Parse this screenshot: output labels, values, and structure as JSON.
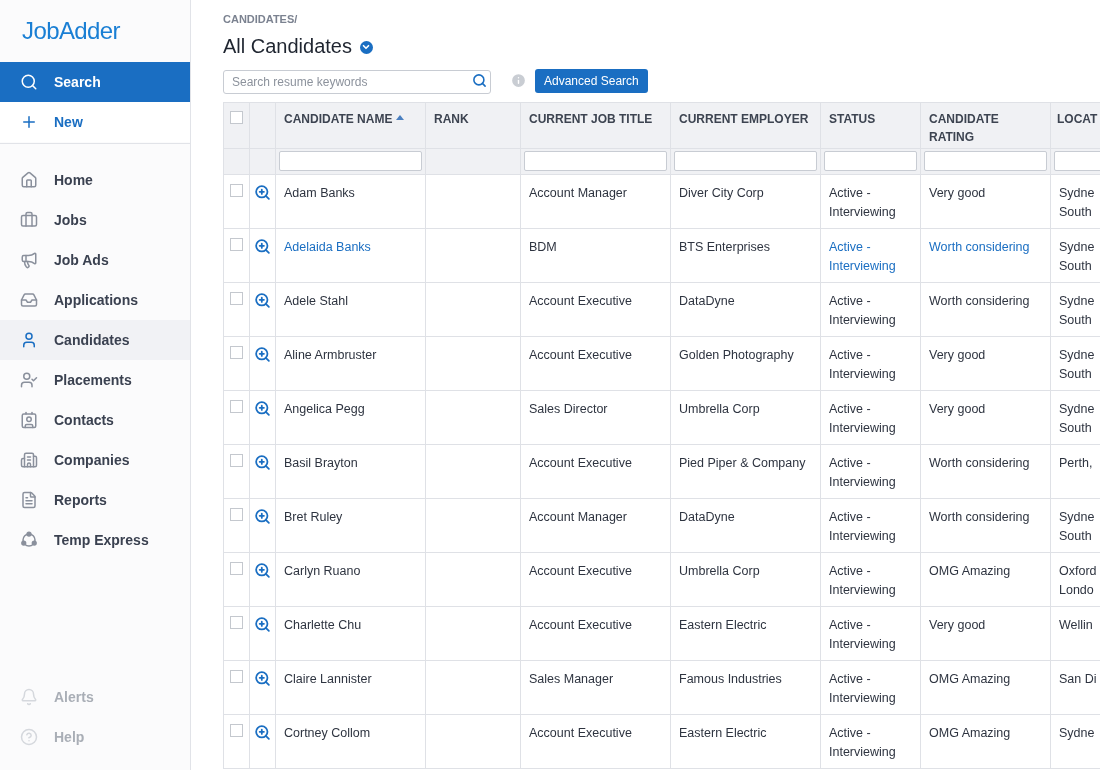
{
  "sidebar": {
    "logo": "JobAdder",
    "actions": [
      {
        "label": "Search",
        "selected": true
      },
      {
        "label": "New",
        "selected": false
      }
    ],
    "items": [
      {
        "label": "Home",
        "selected": false,
        "disabled": false
      },
      {
        "label": "Jobs",
        "selected": false,
        "disabled": false
      },
      {
        "label": "Job Ads",
        "selected": false,
        "disabled": false
      },
      {
        "label": "Applications",
        "selected": false,
        "disabled": false
      },
      {
        "label": "Candidates",
        "selected": true,
        "disabled": false
      },
      {
        "label": "Placements",
        "selected": false,
        "disabled": false
      },
      {
        "label": "Contacts",
        "selected": false,
        "disabled": false
      },
      {
        "label": "Companies",
        "selected": false,
        "disabled": false
      },
      {
        "label": "Reports",
        "selected": false,
        "disabled": false
      },
      {
        "label": "Temp Express",
        "selected": false,
        "disabled": false
      }
    ],
    "footer": [
      {
        "label": "Alerts",
        "disabled": true
      },
      {
        "label": "Help",
        "disabled": true
      }
    ]
  },
  "breadcrumb": "CANDIDATES/",
  "title": "All Candidates",
  "search": {
    "placeholder": "Search resume keywords"
  },
  "advanced_search": "Advanced Search",
  "table": {
    "select_all": {
      "checked": false
    },
    "columns": [
      {
        "label": "CANDIDATE NAME",
        "sorted": true
      },
      {
        "label": "RANK",
        "sorted": false
      },
      {
        "label": "CURRENT JOB TITLE",
        "sorted": false
      },
      {
        "label": "CURRENT EMPLOYER",
        "sorted": false
      },
      {
        "label": "STATUS",
        "sorted": false
      },
      {
        "label": "CANDIDATE RATING",
        "sorted": false
      },
      {
        "label": "LOCAT",
        "sorted": false
      }
    ],
    "rows": [
      {
        "checked": false,
        "highlighted": false,
        "name": "Adam Banks",
        "job_title": "Account Manager",
        "employer": "Diver City Corp",
        "status": "Active - Interviewing",
        "rating": "Very good",
        "location": [
          "Sydne",
          "South"
        ]
      },
      {
        "checked": false,
        "highlighted": true,
        "name": "Adelaida Banks",
        "job_title": "BDM",
        "employer": "BTS Enterprises",
        "status": "Active - Interviewing",
        "rating": "Worth considering",
        "location": [
          "Sydne",
          "South"
        ]
      },
      {
        "checked": false,
        "highlighted": false,
        "name": "Adele Stahl",
        "job_title": "Account Executive",
        "employer": "DataDyne",
        "status": "Active - Interviewing",
        "rating": "Worth considering",
        "location": [
          "Sydne",
          "South"
        ]
      },
      {
        "checked": false,
        "highlighted": false,
        "name": "Aline Armbruster",
        "job_title": "Account Executive",
        "employer": "Golden Photography",
        "status": "Active - Interviewing",
        "rating": "Very good",
        "location": [
          "Sydne",
          "South"
        ]
      },
      {
        "checked": false,
        "highlighted": false,
        "name": "Angelica Pegg",
        "job_title": "Sales Director",
        "employer": "Umbrella Corp",
        "status": "Active - Interviewing",
        "rating": "Very good",
        "location": [
          "Sydne",
          "South"
        ]
      },
      {
        "checked": false,
        "highlighted": false,
        "name": "Basil Brayton",
        "job_title": "Account Executive",
        "employer": "Pied Piper & Company",
        "status": "Active - Interviewing",
        "rating": "Worth considering",
        "location": [
          "Perth,"
        ]
      },
      {
        "checked": false,
        "highlighted": false,
        "name": "Bret Ruley",
        "job_title": "Account Manager",
        "employer": "DataDyne",
        "status": "Active - Interviewing",
        "rating": "Worth considering",
        "location": [
          "Sydne",
          "South"
        ]
      },
      {
        "checked": false,
        "highlighted": false,
        "name": "Carlyn Ruano",
        "job_title": "Account Executive",
        "employer": "Umbrella Corp",
        "status": "Active - Interviewing",
        "rating": "OMG Amazing",
        "location": [
          "Oxford",
          "Londo"
        ]
      },
      {
        "checked": false,
        "highlighted": false,
        "name": "Charlette Chu",
        "job_title": "Account Executive",
        "employer": "Eastern Electric",
        "status": "Active - Interviewing",
        "rating": "Very good",
        "location": [
          "Wellin"
        ]
      },
      {
        "checked": false,
        "highlighted": false,
        "name": "Claire Lannister",
        "job_title": "Sales Manager",
        "employer": "Famous Industries",
        "status": "Active - Interviewing",
        "rating": "OMG Amazing",
        "location": [
          "San Di"
        ]
      },
      {
        "checked": false,
        "highlighted": false,
        "name": "Cortney Collom",
        "job_title": "Account Executive",
        "employer": "Eastern Electric",
        "status": "Active - Interviewing",
        "rating": "OMG Amazing",
        "location": [
          "Sydne"
        ]
      }
    ]
  }
}
